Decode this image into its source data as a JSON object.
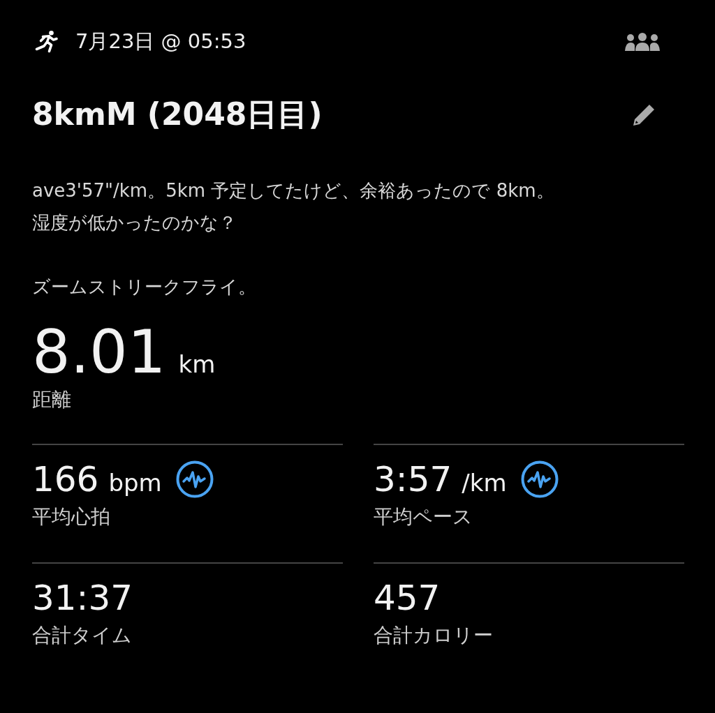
{
  "header": {
    "datetime": "7月23日 @ 05:53"
  },
  "title": "8kmM (2048日目)",
  "description": [
    [
      "ave3'57\"/km。5km 予定してたけど、余裕あったので 8km。",
      "湿度が低かったのかな？"
    ],
    [
      "ズームストリークフライ。"
    ]
  ],
  "distance": {
    "value": "8.01",
    "unit": "km",
    "label": "距離"
  },
  "stats": [
    {
      "value": "166",
      "unit": "bpm",
      "label": "平均心拍",
      "kind": "chart"
    },
    {
      "value": "3:57",
      "unit": "/km",
      "label": "平均ペース",
      "kind": "chart"
    },
    {
      "value": "31:37",
      "label": "合計タイム",
      "kind": "plain"
    },
    {
      "value": "457",
      "label": "合計カロリー",
      "kind": "plain"
    }
  ]
}
